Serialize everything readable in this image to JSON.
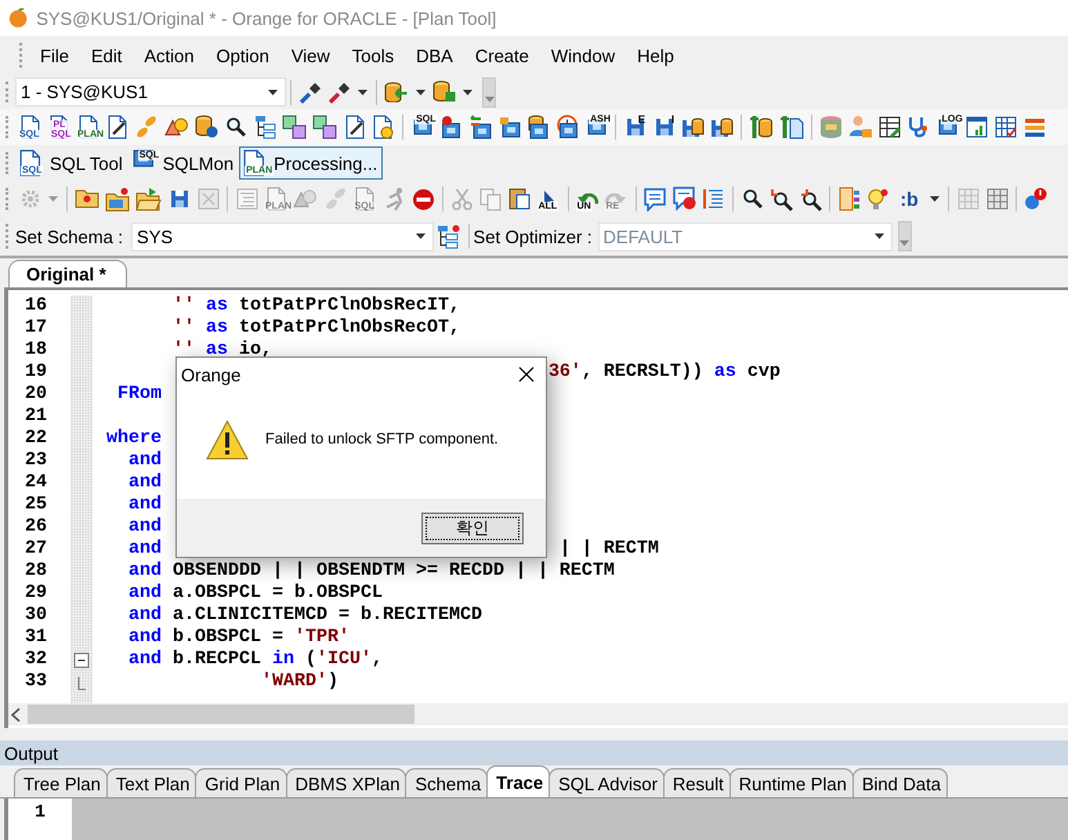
{
  "window": {
    "title": "SYS@KUS1/Original * - Orange for ORACLE - [Plan Tool]",
    "active": false
  },
  "menu": [
    "File",
    "Edit",
    "Action",
    "Option",
    "View",
    "Tools",
    "DBA",
    "Create",
    "Window",
    "Help"
  ],
  "connection_toolbar": {
    "connection": "1 - SYS@KUS1",
    "groups": [
      [
        {
          "kind": "plug"
        },
        {
          "kind": "plugred"
        },
        {
          "kind": "caret"
        }
      ],
      [
        {
          "kind": "dbin"
        },
        {
          "kind": "caret"
        },
        {
          "kind": "dbout"
        },
        {
          "kind": "caret"
        }
      ]
    ]
  },
  "tool_toolbar": [
    [
      {
        "kind": "doc",
        "label": "SQL",
        "color": "#1f5fb0"
      },
      {
        "kind": "doc",
        "label": "PL SQL",
        "color": "#a020c0"
      },
      {
        "kind": "doc",
        "label": "PLAN",
        "color": "#207030"
      },
      {
        "kind": "docpen"
      },
      {
        "kind": "pills"
      },
      {
        "kind": "shapes"
      },
      {
        "kind": "dbinfo"
      },
      {
        "kind": "search"
      },
      {
        "kind": "tree"
      },
      {
        "kind": "tiles"
      },
      {
        "kind": "tiles"
      },
      {
        "kind": "docpen"
      },
      {
        "kind": "docshapes"
      }
    ],
    [
      {
        "kind": "monitor",
        "label": "SQL",
        "color": "#111111"
      },
      {
        "kind": "monitorgear"
      },
      {
        "kind": "monitorarrows"
      },
      {
        "kind": "monitorlock"
      },
      {
        "kind": "monitordb"
      },
      {
        "kind": "monitorclock"
      },
      {
        "kind": "monitor",
        "label": "ASH",
        "color": "#111111"
      }
    ],
    [
      {
        "kind": "floppy",
        "label": "E",
        "color": "#111111"
      },
      {
        "kind": "floppy",
        "label": "I",
        "color": "#111111"
      },
      {
        "kind": "floppydb"
      },
      {
        "kind": "floppydb"
      }
    ],
    [
      {
        "kind": "wrenchdb"
      },
      {
        "kind": "wrenchdoc"
      }
    ],
    [
      {
        "kind": "dbcolor"
      },
      {
        "kind": "person"
      },
      {
        "kind": "table"
      },
      {
        "kind": "steth"
      },
      {
        "kind": "monitor",
        "label": "LOG",
        "color": "#111111"
      },
      {
        "kind": "chart"
      },
      {
        "kind": "calendar"
      },
      {
        "kind": "bars"
      }
    ]
  ],
  "window_toolbar": [
    {
      "kind": "doc",
      "icon_label": "SQL",
      "color": "#1f5fb0",
      "text": "SQL Tool",
      "selected": false
    },
    {
      "kind": "monitor",
      "icon_label": "SQL",
      "color": "#111111",
      "text": "SQLMon",
      "selected": false
    },
    {
      "kind": "doc",
      "icon_label": "PLAN",
      "color": "#207030",
      "text": "Processing...",
      "selected": true
    }
  ],
  "edit_toolbar": [
    [
      {
        "kind": "gear",
        "disabled": true
      },
      {
        "kind": "caret",
        "disabled": true
      }
    ],
    [
      {
        "kind": "folderstar",
        "disabled": false
      },
      {
        "kind": "foldernew",
        "disabled": false
      },
      {
        "kind": "folderopen",
        "disabled": false
      },
      {
        "kind": "floppy",
        "disabled": false
      },
      {
        "kind": "box",
        "disabled": true
      }
    ],
    [
      {
        "kind": "lines",
        "disabled": true
      },
      {
        "kind": "doc",
        "label": "PLAN",
        "disabled": true
      },
      {
        "kind": "shapes",
        "disabled": true
      },
      {
        "kind": "pills",
        "disabled": true
      },
      {
        "kind": "doc",
        "label": "SQL",
        "disabled": true
      },
      {
        "kind": "runner",
        "disabled": true
      },
      {
        "kind": "stop",
        "disabled": false
      }
    ],
    [
      {
        "kind": "cut",
        "disabled": true
      },
      {
        "kind": "copy",
        "disabled": true
      },
      {
        "kind": "paste",
        "disabled": false
      },
      {
        "kind": "cursor",
        "label": "ALL",
        "disabled": false
      }
    ],
    [
      {
        "kind": "undo",
        "label": "UN",
        "disabled": false
      },
      {
        "kind": "redo",
        "label": "RE",
        "disabled": true
      }
    ],
    [
      {
        "kind": "comment",
        "disabled": false
      },
      {
        "kind": "commentdel",
        "disabled": false
      },
      {
        "kind": "indent",
        "disabled": false
      }
    ],
    [
      {
        "kind": "search",
        "disabled": false
      },
      {
        "kind": "searchprev",
        "disabled": false
      },
      {
        "kind": "searchnext",
        "disabled": false
      }
    ],
    [
      {
        "kind": "doctree",
        "disabled": false
      },
      {
        "kind": "bulb",
        "disabled": false
      },
      {
        "kind": "text",
        "label": ":b",
        "disabled": false
      },
      {
        "kind": "caret",
        "disabled": false
      }
    ],
    [
      {
        "kind": "grid",
        "disabled": true
      },
      {
        "kind": "grid",
        "disabled": false
      }
    ],
    [
      {
        "kind": "bug",
        "disabled": false
      }
    ]
  ],
  "schema_bar": {
    "schema_label": "Set Schema :",
    "schema": "SYS",
    "optimizer_label": "Set Optimizer :",
    "optimizer": "DEFAULT"
  },
  "editor": {
    "tabs": [
      {
        "label": "Original *",
        "selected": true
      }
    ],
    "lines": [
      {
        "number": "16",
        "kind": "code",
        "segments": [
          [
            {
              "kind": "string",
              "text": "       ''"
            },
            {
              "kind": "keyword",
              "text": " as"
            },
            {
              "kind": "plain",
              "text": " totPatPrClnObsRecIT,"
            }
          ]
        ]
      },
      {
        "number": "17",
        "kind": "code",
        "segments": [
          [
            {
              "kind": "string",
              "text": "       ''"
            },
            {
              "kind": "keyword",
              "text": " as"
            },
            {
              "kind": "plain",
              "text": " totPatPrClnObsRecOT,"
            }
          ]
        ]
      },
      {
        "number": "18",
        "kind": "code",
        "segments": [
          [
            {
              "kind": "string",
              "text": "       ''"
            },
            {
              "kind": "keyword",
              "text": " as"
            },
            {
              "kind": "plain",
              "text": " io,"
            }
          ]
        ]
      },
      {
        "number": "19",
        "kind": "code",
        "segments": [
          [
            {
              "kind": "string",
              "text": "                                         36'"
            },
            {
              "kind": "plain",
              "text": ", RECRSLT))"
            },
            {
              "kind": "keyword",
              "text": " as"
            },
            {
              "kind": "plain",
              "text": " cvp"
            }
          ]
        ]
      },
      {
        "number": "20",
        "kind": "code",
        "segments": [
          [
            {
              "kind": "keyword",
              "text": "  FRom"
            }
          ]
        ]
      },
      {
        "number": "21",
        "kind": "code"
      },
      {
        "number": "22",
        "kind": "code",
        "segments": [
          [
            {
              "kind": "keyword",
              "text": " where"
            }
          ]
        ]
      },
      {
        "number": "23",
        "kind": "code",
        "segments": [
          [
            {
              "kind": "keyword",
              "text": "   and"
            }
          ]
        ]
      },
      {
        "number": "24",
        "kind": "code",
        "segments": [
          [
            {
              "kind": "keyword",
              "text": "   and"
            }
          ]
        ]
      },
      {
        "number": "25",
        "kind": "code",
        "segments": [
          [
            {
              "kind": "keyword",
              "text": "   and"
            }
          ]
        ]
      },
      {
        "number": "26",
        "kind": "code",
        "segments": [
          [
            {
              "kind": "keyword",
              "text": "   and"
            }
          ]
        ]
      },
      {
        "number": "27",
        "kind": "code",
        "segments": [
          [
            {
              "kind": "keyword",
              "text": "   and"
            }
          ],
          [
            {
              "kind": "plain",
              "text": "                                    | | RECTM"
            }
          ]
        ]
      },
      {
        "number": "28",
        "kind": "code",
        "segments": [
          [
            {
              "kind": "keyword",
              "text": "   and"
            },
            {
              "kind": "plain",
              "text": " OBSENDDD | | OBSENDTM >= RECDD | | RECTM"
            }
          ]
        ]
      },
      {
        "number": "29",
        "kind": "code",
        "segments": [
          [
            {
              "kind": "keyword",
              "text": "   and"
            },
            {
              "kind": "plain",
              "text": " a.OBSPCL = b.OBSPCL"
            }
          ]
        ]
      },
      {
        "number": "30",
        "kind": "code",
        "segments": [
          [
            {
              "kind": "keyword",
              "text": "   and"
            },
            {
              "kind": "plain",
              "text": " a.CLINICITEMCD = b.RECITEMCD"
            }
          ]
        ]
      },
      {
        "number": "31",
        "kind": "code",
        "segments": [
          [
            {
              "kind": "keyword",
              "text": "   and"
            },
            {
              "kind": "plain",
              "text": " b.OBSPCL = "
            },
            {
              "kind": "string",
              "text": "'TPR'"
            }
          ]
        ]
      },
      {
        "number": "32",
        "kind": "fold_start",
        "segments": [
          [
            {
              "kind": "keyword",
              "text": "   and"
            },
            {
              "kind": "plain",
              "text": " b.RECPCL "
            },
            {
              "kind": "keyword",
              "text": "in"
            },
            {
              "kind": "plain",
              "text": " ("
            },
            {
              "kind": "string",
              "text": "'ICU'"
            },
            {
              "kind": "plain",
              "text": ","
            }
          ]
        ]
      },
      {
        "number": "33",
        "kind": "fold_end",
        "segments": [
          [
            {
              "kind": "string",
              "text": "               'WARD'"
            },
            {
              "kind": "plain",
              "text": ")"
            }
          ]
        ]
      }
    ]
  },
  "dialog": {
    "title": "Orange",
    "message": "Failed to unlock SFTP component.",
    "button": "확인"
  },
  "output": {
    "title": "Output",
    "tabs": [
      {
        "label": "Tree Plan",
        "selected": false
      },
      {
        "label": "Text Plan",
        "selected": false
      },
      {
        "label": "Grid Plan",
        "selected": false
      },
      {
        "label": "DBMS XPlan",
        "selected": false
      },
      {
        "label": "Schema",
        "selected": false
      },
      {
        "label": "Trace",
        "selected": true
      },
      {
        "label": "SQL Advisor",
        "selected": false
      },
      {
        "label": "Result",
        "selected": false
      },
      {
        "label": "Runtime Plan",
        "selected": false
      },
      {
        "label": "Bind Data",
        "selected": false
      }
    ],
    "lines": [
      "1"
    ]
  }
}
